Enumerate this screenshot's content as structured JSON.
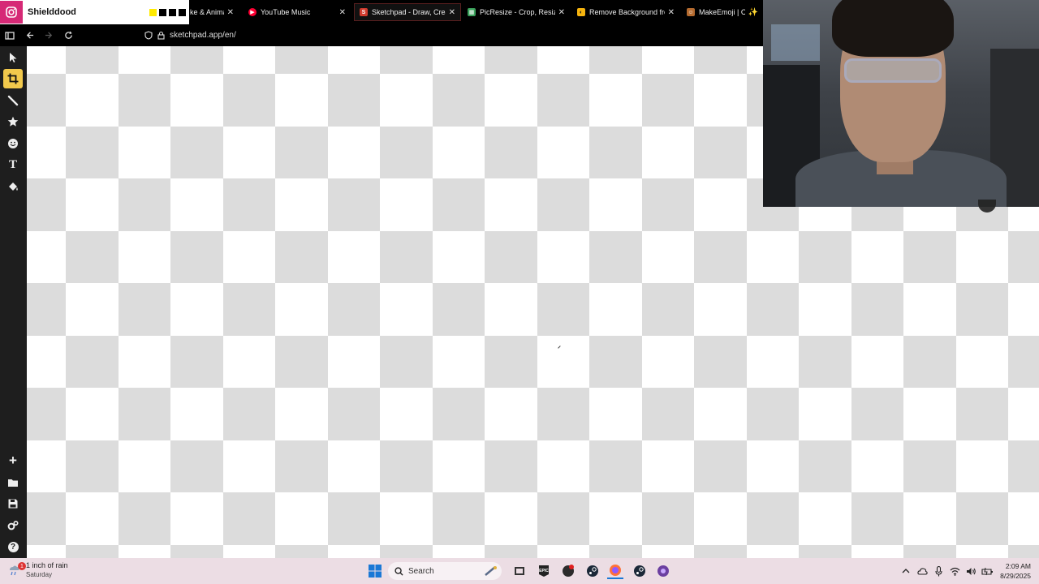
{
  "overlay": {
    "title": "Shielddood",
    "swatch_colors": [
      "#ffea00",
      "#000000",
      "#000000",
      "#000000"
    ]
  },
  "tabs": [
    {
      "title": "ke & Animat",
      "close": "✕",
      "favicon_color": "#e0286e",
      "favicon_glyph": ""
    },
    {
      "title": "YouTube Music",
      "close": "✕",
      "favicon_color": "#ff0033",
      "favicon_glyph": "▶"
    },
    {
      "title": "Sketchpad - Draw, Create, S",
      "close": "✕",
      "favicon_color": "#d13b2e",
      "favicon_glyph": "S",
      "active": true
    },
    {
      "title": "PicResize - Crop, Resize, Ed",
      "close": "✕",
      "favicon_color": "#3aa15b",
      "favicon_glyph": "▦"
    },
    {
      "title": "Remove Background from",
      "close": "✕",
      "favicon_color": "#f6b40e",
      "favicon_glyph": "◐"
    },
    {
      "title": "MakeEmoji | Create",
      "close": "✨",
      "favicon_color": "#b56b2f",
      "favicon_glyph": "☺"
    }
  ],
  "navbar": {
    "url": "sketchpad.app/en/"
  },
  "tools": [
    {
      "name": "select-tool",
      "icon": "cursor-icon"
    },
    {
      "name": "crop-tool",
      "icon": "crop-icon",
      "active": true
    },
    {
      "name": "brush-tool",
      "icon": "brush-icon"
    },
    {
      "name": "stamp-tool",
      "icon": "star-icon"
    },
    {
      "name": "sticker-tool",
      "icon": "emoji-icon"
    },
    {
      "name": "text-tool",
      "icon": "text-icon",
      "glyph": "T"
    },
    {
      "name": "fill-tool",
      "icon": "paint-bucket-icon"
    },
    {
      "name": "new-tool",
      "icon": "plus-icon",
      "glyph": "+"
    },
    {
      "name": "open-tool",
      "icon": "folder-icon"
    },
    {
      "name": "save-tool",
      "icon": "save-icon"
    },
    {
      "name": "settings-tool",
      "icon": "settings-icon"
    },
    {
      "name": "help-tool",
      "icon": "help-icon",
      "glyph": "?"
    }
  ],
  "taskbar": {
    "weather_text": "1 inch of rain",
    "weather_day": "Saturday",
    "weather_badge": "1",
    "search_label": "Search",
    "time": "2:09 AM",
    "date": "8/29/2025"
  }
}
